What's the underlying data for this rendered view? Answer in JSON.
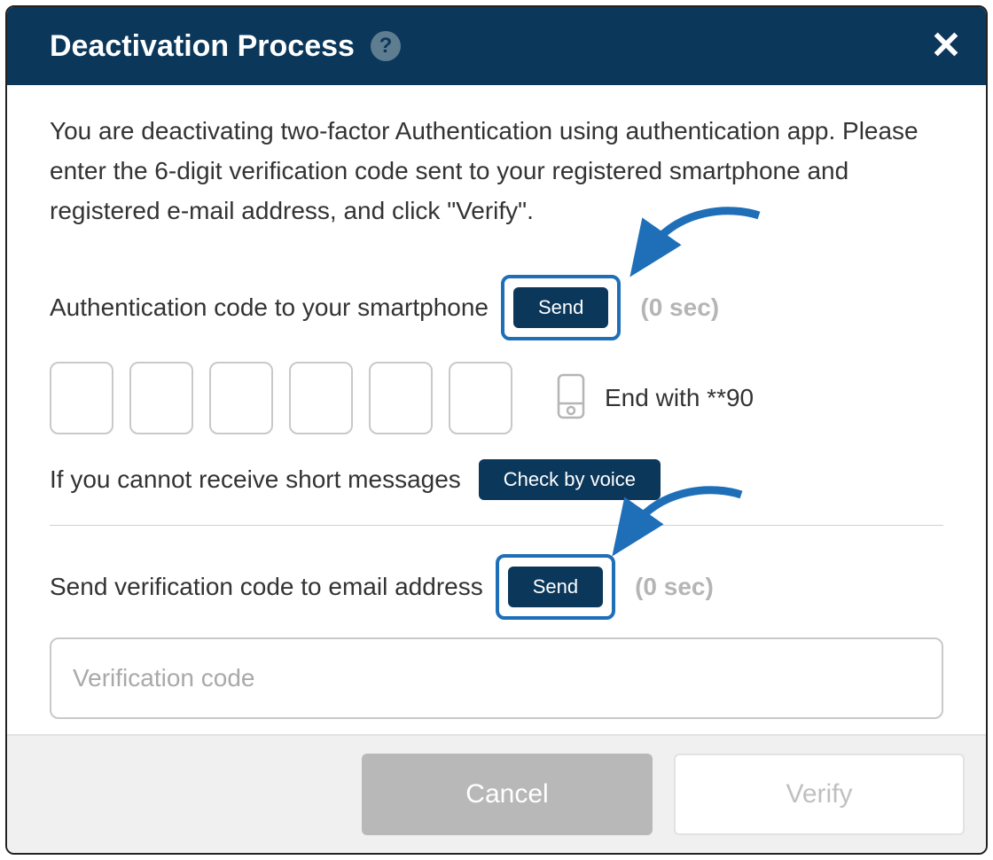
{
  "header": {
    "title": "Deactivation Process",
    "help": "?",
    "close": "×"
  },
  "intro": "You are deactivating two-factor Authentication using authentication app. Please enter the 6-digit verification code sent to your registered smartphone and registered e-mail address, and click \"Verify\".",
  "sms": {
    "label": "Authentication code to your smartphone",
    "send": "Send",
    "timer": "(0 sec)",
    "device_hint": "End with **90",
    "voice_label": "If you cannot receive short messages",
    "voice_button": "Check by voice"
  },
  "email": {
    "label": "Send verification code to email address",
    "send": "Send",
    "timer": "(0 sec)",
    "placeholder": "Verification code"
  },
  "footer": {
    "cancel": "Cancel",
    "verify": "Verify"
  }
}
